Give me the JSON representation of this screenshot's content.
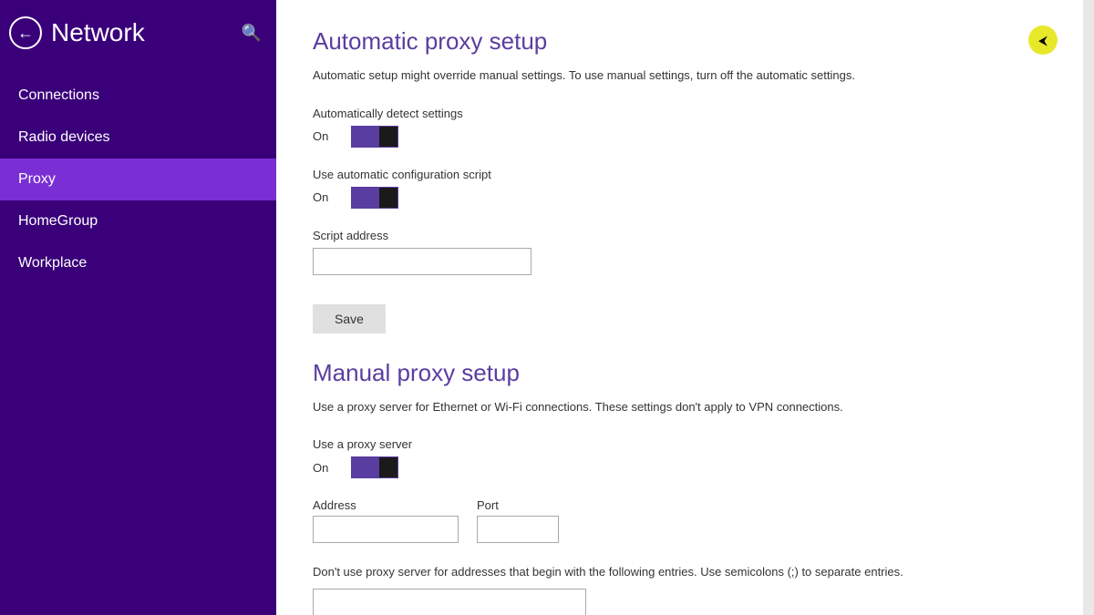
{
  "sidebar": {
    "back_button_label": "←",
    "title": "Network",
    "search_icon": "🔍",
    "nav_items": [
      {
        "id": "connections",
        "label": "Connections",
        "active": false
      },
      {
        "id": "radio-devices",
        "label": "Radio devices",
        "active": false
      },
      {
        "id": "proxy",
        "label": "Proxy",
        "active": true
      },
      {
        "id": "homegroup",
        "label": "HomeGroup",
        "active": false
      },
      {
        "id": "workplace",
        "label": "Workplace",
        "active": false
      }
    ]
  },
  "main": {
    "automatic_proxy_setup": {
      "title": "Automatic proxy setup",
      "description": "Automatic setup might override manual settings. To use manual settings, turn off the automatic settings.",
      "auto_detect": {
        "label": "Automatically detect settings",
        "state": "On"
      },
      "auto_config_script": {
        "label": "Use automatic configuration script",
        "state": "On"
      },
      "script_address": {
        "label": "Script address",
        "placeholder": "",
        "value": ""
      },
      "save_button": "Save"
    },
    "manual_proxy_setup": {
      "title": "Manual proxy setup",
      "description": "Use a proxy server for Ethernet or Wi-Fi connections. These settings don't apply to VPN connections.",
      "use_proxy": {
        "label": "Use a proxy server",
        "state": "On"
      },
      "address": {
        "label": "Address",
        "placeholder": "",
        "value": ""
      },
      "port": {
        "label": "Port",
        "placeholder": "",
        "value": ""
      },
      "exceptions_note": "Don't use proxy server for addresses that begin with the following entries. Use semicolons (;) to separate entries."
    }
  }
}
